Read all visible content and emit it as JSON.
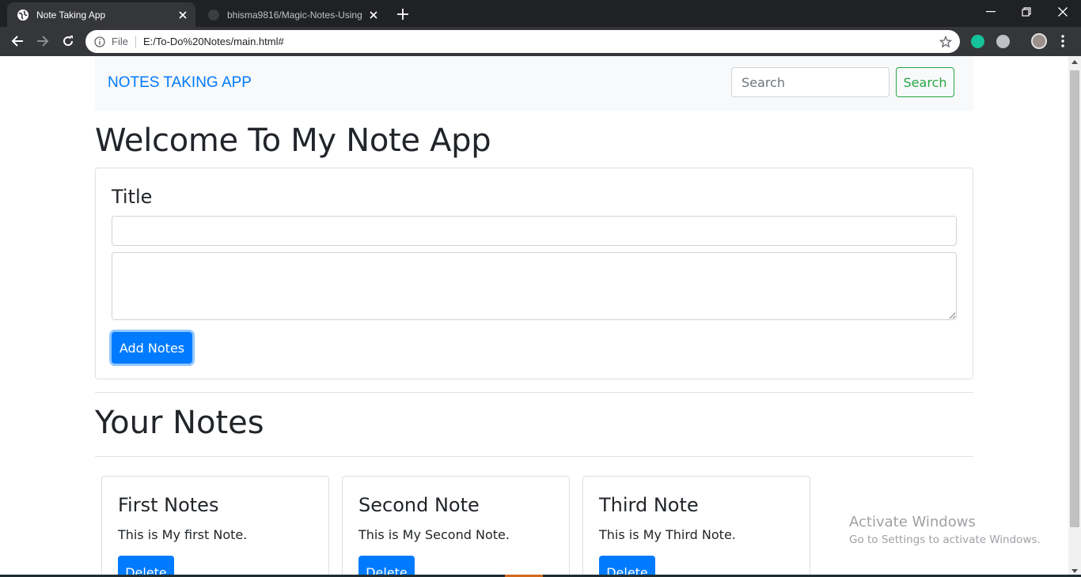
{
  "browser": {
    "tabs": [
      {
        "title": "Note Taking App",
        "icon": "globe-icon",
        "active": true
      },
      {
        "title": "bhisma9816/Magic-Notes-Using",
        "icon": "github-icon",
        "active": false
      }
    ],
    "omnibox": {
      "scheme": "File",
      "url": "E:/To-Do%20Notes/main.html#"
    }
  },
  "navbar": {
    "brand": "NOTES TAKING APP",
    "search_placeholder": "Search",
    "search_button": "Search"
  },
  "heading": "Welcome To My Note App",
  "form": {
    "title_label": "Title",
    "title_value": "",
    "body_value": "",
    "add_button": "Add Notes"
  },
  "notes_heading": "Your Notes",
  "notes": [
    {
      "title": "First Notes",
      "text": "This is My first Note.",
      "button": "Delete"
    },
    {
      "title": "Second Note",
      "text": "This is My Second Note.",
      "button": "Delete"
    },
    {
      "title": "Third Note",
      "text": "This is My Third Note.",
      "button": "Delete"
    }
  ],
  "watermark": {
    "line1": "Activate Windows",
    "line2": "Go to Settings to activate Windows."
  },
  "colors": {
    "primary": "#007bff",
    "success": "#28a745",
    "chrome_dark": "#202124",
    "chrome_toolbar": "#35363a"
  }
}
